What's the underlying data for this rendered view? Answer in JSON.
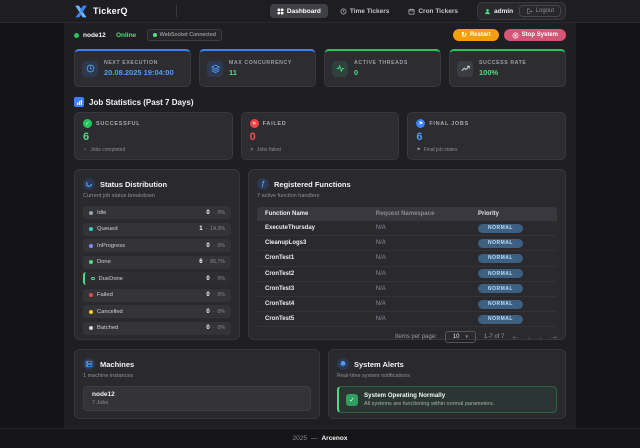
{
  "colors": {
    "accent_blue": "#4a9eff",
    "green": "#4ade80",
    "red": "#ef5350",
    "orange": "#f59e0b",
    "rose": "#d65577"
  },
  "icons": {
    "restart": "↻",
    "dropdown": "▾",
    "check": "✓",
    "cross": "✕",
    "flag": "⚑",
    "function": "ƒ",
    "pager_first": "⇤",
    "pager_prev": "‹",
    "pager_next": "›",
    "pager_last": "⇥",
    "caption_success": "✓",
    "caption_failed": "✕",
    "caption_final": "⚑"
  },
  "header": {
    "title": "TickerQ",
    "nav": [
      {
        "label": "Dashboard"
      },
      {
        "label": "Time Tickers"
      },
      {
        "label": "Cron Tickers"
      }
    ],
    "username": "admin",
    "logout": "Logout"
  },
  "statusbar": {
    "node": "node12",
    "sep": "·",
    "online": "Online",
    "websocket": "WebSocket Connected",
    "restart": "Restart",
    "stop": "Stop System"
  },
  "stats": [
    {
      "label": "NEXT EXECUTION",
      "value": "20.08.2025 19:04:00",
      "accent": "#3b82f6",
      "value_color": "#4a9eff",
      "icon_bg": "rgba(59,130,246,0.15)"
    },
    {
      "label": "MAX CONCURRENCY",
      "value": "11",
      "accent": "#3b82f6",
      "value_color": "#4ade80",
      "icon_bg": "rgba(59,130,246,0.15)"
    },
    {
      "label": "ACTIVE THREADS",
      "value": "0",
      "accent": "#22c55e",
      "value_color": "#4ade80",
      "icon_bg": "rgba(74,222,128,0.12)"
    },
    {
      "label": "SUCCESS RATE",
      "value": "100%",
      "accent": "#22c55e",
      "value_color": "#4ade80",
      "icon_bg": "rgba(120,130,140,0.2)"
    }
  ],
  "job_stats": {
    "title": "Job Statistics (Past 7 Days)",
    "cards": [
      {
        "label": "SUCCESSFUL",
        "value": "6",
        "caption": "Jobs completed",
        "color": "#4ade80",
        "circle": "#22c55e"
      },
      {
        "label": "FAILED",
        "value": "0",
        "caption": "Jobs failed",
        "color": "#ef5350",
        "circle": "#ef4444"
      },
      {
        "label": "FINAL JOBS",
        "value": "6",
        "caption": "Final job states",
        "color": "#4a9eff",
        "circle": "#3b82f6"
      }
    ]
  },
  "status_distribution": {
    "title": "Status Distribution",
    "subtitle": "Current job status breakdown",
    "sep": "·",
    "rows": [
      {
        "label": "Idle",
        "count": "0",
        "pct": "0%",
        "color": "#9ca3af"
      },
      {
        "label": "Queued",
        "count": "1",
        "pct": "14.3%",
        "color": "#2dd4bf"
      },
      {
        "label": "InProgress",
        "count": "0",
        "pct": "0%",
        "color": "#818cf8"
      },
      {
        "label": "Done",
        "count": "6",
        "pct": "85.7%",
        "color": "#4ade80"
      },
      {
        "label": "DueDone",
        "count": "0",
        "pct": "0%",
        "color": "#4ade80"
      },
      {
        "label": "Failed",
        "count": "0",
        "pct": "0%",
        "color": "#ef4444"
      },
      {
        "label": "Cancelled",
        "count": "0",
        "pct": "0%",
        "color": "#facc15"
      },
      {
        "label": "Batched",
        "count": "0",
        "pct": "0%",
        "color": "#d1d5db"
      }
    ]
  },
  "functions": {
    "title": "Registered Functions",
    "subtitle": "7 active function handlers",
    "columns": [
      "Function Name",
      "Request Namespace",
      "Priority"
    ],
    "rows": [
      {
        "name": "ExecuteThursday",
        "namespace": "N/A",
        "priority": "NORMAL"
      },
      {
        "name": "CleanupLogs3",
        "namespace": "N/A",
        "priority": "NORMAL"
      },
      {
        "name": "CronTest1",
        "namespace": "N/A",
        "priority": "NORMAL"
      },
      {
        "name": "CronTest2",
        "namespace": "N/A",
        "priority": "NORMAL"
      },
      {
        "name": "CronTest3",
        "namespace": "N/A",
        "priority": "NORMAL"
      },
      {
        "name": "CronTest4",
        "namespace": "N/A",
        "priority": "NORMAL"
      },
      {
        "name": "CronTest5",
        "namespace": "N/A",
        "priority": "NORMAL"
      }
    ],
    "pagination": {
      "items_per_page_label": "Items per page:",
      "page_size": "10",
      "range": "1-7 of 7"
    }
  },
  "machines": {
    "title": "Machines",
    "subtitle": "1 machine instances",
    "items": [
      {
        "name": "node12",
        "jobs": "7 Jobs"
      }
    ]
  },
  "alerts": {
    "title": "System Alerts",
    "subtitle": "Real-time system notifications",
    "items": [
      {
        "title": "System Operating Normally",
        "message": "All systems are functioning within normal parameters."
      }
    ]
  },
  "footer": {
    "year": "2025",
    "sep": "—",
    "brand": "Arcenox"
  }
}
